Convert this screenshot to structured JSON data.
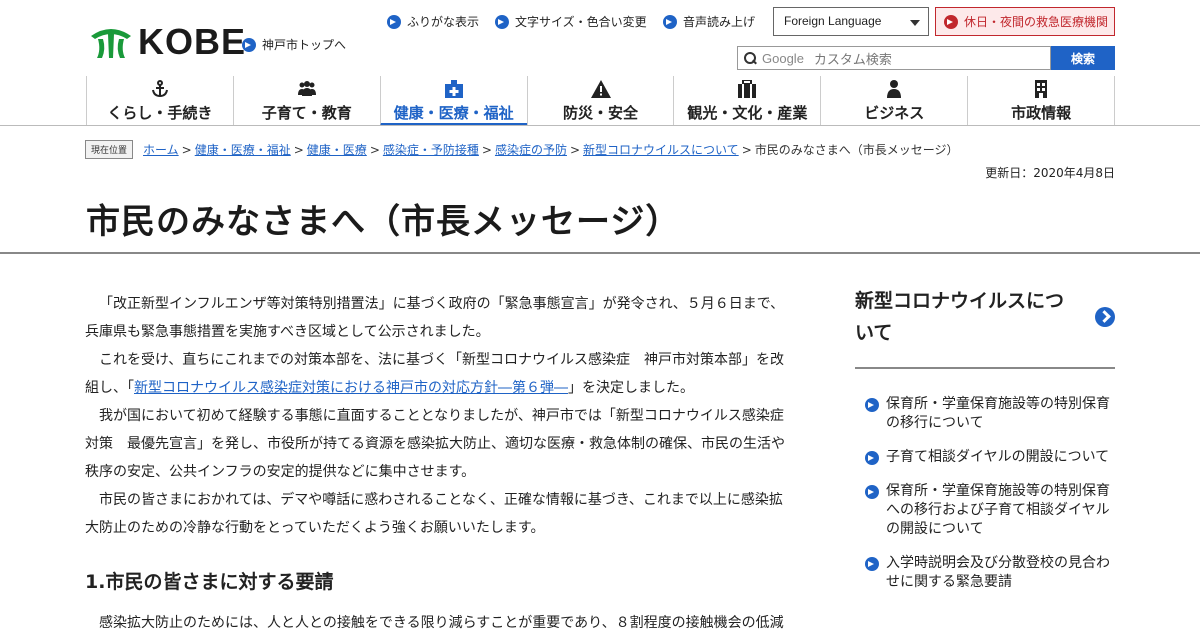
{
  "header": {
    "logo_text": "KOBE",
    "top_link": "神戸市トップへ",
    "utilities": [
      "ふりがな表示",
      "文字サイズ・色合い変更",
      "音声読み上げ"
    ],
    "language_select": "Foreign Language",
    "emergency_link": "休日・夜間の救急医療機関",
    "search": {
      "brand": "Google",
      "placeholder": "カスタム検索",
      "button": "検索"
    }
  },
  "nav": [
    {
      "label": "くらし・手続き",
      "icon": "anchor-icon"
    },
    {
      "label": "子育て・教育",
      "icon": "people-icon"
    },
    {
      "label": "健康・医療・福祉",
      "icon": "medical-cross-icon",
      "active": true
    },
    {
      "label": "防災・安全",
      "icon": "warning-icon"
    },
    {
      "label": "観光・文化・産業",
      "icon": "suitcase-icon"
    },
    {
      "label": "ビジネス",
      "icon": "person-icon"
    },
    {
      "label": "市政情報",
      "icon": "building-icon"
    }
  ],
  "breadcrumb": {
    "here_label": "現在位置",
    "links": [
      "ホーム",
      "健康・医療・福祉",
      "健康・医療",
      "感染症・予防接種",
      "感染症の予防",
      "新型コロナウイルスについて"
    ],
    "current": "市民のみなさまへ（市長メッセージ）"
  },
  "updated": "更新日：2020年4月8日",
  "page_title": "市民のみなさまへ（市長メッセージ）",
  "main": {
    "p1": "「改正新型インフルエンザ等対策特別措置法」に基づく政府の「緊急事態宣言」が発令され、５月６日まで、兵庫県も緊急事態措置を実施すべき区域として公示されました。",
    "p2_before": "これを受け、直ちにこれまでの対策本部を、法に基づく「新型コロナウイルス感染症　神戸市対策本部」を改組し、「",
    "p2_link": "新型コロナウイルス感染症対策における神戸市の対応方針―第６弾―",
    "p2_after": "」を決定しました。",
    "p3": "我が国において初めて経験する事態に直面することとなりましたが、神戸市では「新型コロナウイルス感染症対策　最優先宣言」を発し、市役所が持てる資源を感染拡大防止、適切な医療・救急体制の確保、市民の生活や秩序の安定、公共インフラの安定的提供などに集中させます。",
    "p4": "市民の皆さまにおかれては、デマや噂話に惑わされることなく、正確な情報に基づき、これまで以上に感染拡大防止のための冷静な行動をとっていただくよう強くお願いいたします。",
    "h2": "1.市民の皆さまに対する要請",
    "p5": "感染拡大防止のためには、人と人との接触をできる限り減らすことが重要であり、８割程度の接触機会の低減"
  },
  "side": {
    "title": "新型コロナウイルスについて",
    "items": [
      "保育所・学童保育施設等の特別保育の移行について",
      "子育て相談ダイヤルの開設について",
      "保育所・学童保育施設等の特別保育への移行および子育て相談ダイヤルの開設について",
      "入学時説明会及び分散登校の見合わせに関する緊急要請"
    ]
  },
  "colors": {
    "accent": "#1f63c6",
    "emergency": "#c1272d",
    "logo_green": "#1a9a3a"
  }
}
